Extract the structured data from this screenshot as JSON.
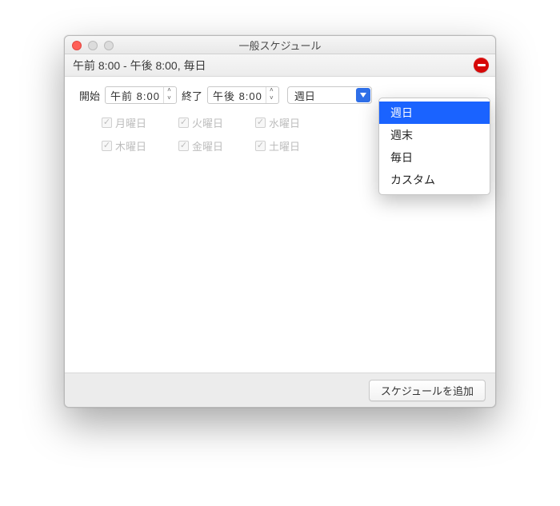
{
  "window": {
    "title": "一般スケジュール"
  },
  "summary": {
    "text": "午前 8:00 - 午後 8:00, 毎日"
  },
  "form": {
    "start_label": "開始",
    "start_value": "午前  8:00",
    "end_label": "終了",
    "end_value": "午後  8:00"
  },
  "combo": {
    "selected": "週日",
    "options": [
      "週日",
      "週末",
      "毎日",
      "カスタム"
    ],
    "selected_index": 0
  },
  "days": {
    "row1": [
      "月曜日",
      "火曜日",
      "水曜日",
      ""
    ],
    "row2": [
      "木曜日",
      "金曜日",
      "土曜日",
      ""
    ]
  },
  "footer": {
    "add_label": "スケジュールを追加"
  }
}
